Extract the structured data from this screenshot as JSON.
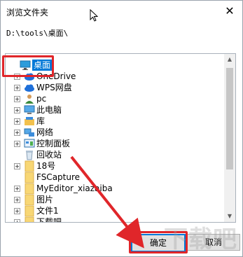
{
  "dialog": {
    "title": "浏览文件夹",
    "close_glyph": "✕",
    "path": "D:\\tools\\桌面\\"
  },
  "tree": {
    "items": [
      {
        "label": "桌面",
        "icon": "desktop-icon",
        "selected": true,
        "expander": false
      },
      {
        "label": "OneDrive",
        "icon": "cloud-icon",
        "selected": false,
        "expander": true
      },
      {
        "label": "WPS网盘",
        "icon": "cloud-icon",
        "selected": false,
        "expander": true
      },
      {
        "label": "pc",
        "icon": "user-icon",
        "selected": false,
        "expander": true
      },
      {
        "label": "此电脑",
        "icon": "computer-icon",
        "selected": false,
        "expander": true
      },
      {
        "label": "库",
        "icon": "library-icon",
        "selected": false,
        "expander": true
      },
      {
        "label": "网络",
        "icon": "network-icon",
        "selected": false,
        "expander": true
      },
      {
        "label": "控制面板",
        "icon": "control-panel-icon",
        "selected": false,
        "expander": true
      },
      {
        "label": "回收站",
        "icon": "recycle-bin-icon",
        "selected": false,
        "expander": false
      },
      {
        "label": "18号",
        "icon": "folder-icon",
        "selected": false,
        "expander": true
      },
      {
        "label": "FSCapture",
        "icon": "folder-icon",
        "selected": false,
        "expander": false
      },
      {
        "label": "MyEditor_xiazaiba",
        "icon": "folder-icon",
        "selected": false,
        "expander": true
      },
      {
        "label": "图片",
        "icon": "folder-icon",
        "selected": false,
        "expander": true
      },
      {
        "label": "文件1",
        "icon": "folder-icon",
        "selected": false,
        "expander": true
      },
      {
        "label": "下载吧",
        "icon": "folder-icon",
        "selected": false,
        "expander": true
      }
    ]
  },
  "scrollbar": {
    "up": "▲",
    "down": "▼"
  },
  "buttons": {
    "ok": "确定",
    "cancel": "取消"
  },
  "watermark": "下载吧",
  "colors": {
    "selection": "#0078d7",
    "highlight": "#e0262a"
  }
}
